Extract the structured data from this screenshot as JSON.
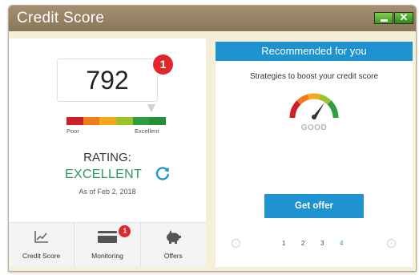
{
  "window": {
    "title": "Credit Score",
    "controls": {
      "minimize_icon": "minimize-icon",
      "close_glyph": "✕"
    }
  },
  "score": {
    "value": "792",
    "badge_count": "1",
    "scale_colors": [
      "#cc1f27",
      "#f07d1c",
      "#f5a81a",
      "#9ac22a",
      "#2e9e3f",
      "#22913a"
    ],
    "scale_low": "Poor",
    "scale_high": "Excellent",
    "rating_label": "RATING:",
    "rating_value": "EXCELLENT",
    "as_of": "As of Feb 2, 2018"
  },
  "nav": {
    "items": [
      {
        "label": "Credit Score",
        "icon": "chart-icon"
      },
      {
        "label": "Monitoring",
        "icon": "card-icon",
        "badge": "1"
      },
      {
        "label": "Offers",
        "icon": "piggy-bank-icon"
      }
    ]
  },
  "recommendation": {
    "header": "Recommended for you",
    "subtitle": "Strategies to boost your credit score",
    "gauge_label": "GOOD",
    "button_label": "Get offer",
    "pages": [
      "1",
      "2",
      "3",
      "4"
    ],
    "active_page": "4",
    "prev_glyph": "‹",
    "next_glyph": "›"
  },
  "colors": {
    "accent": "#1e93cf",
    "excellent": "#2a9a57",
    "badge": "#e0272b"
  }
}
